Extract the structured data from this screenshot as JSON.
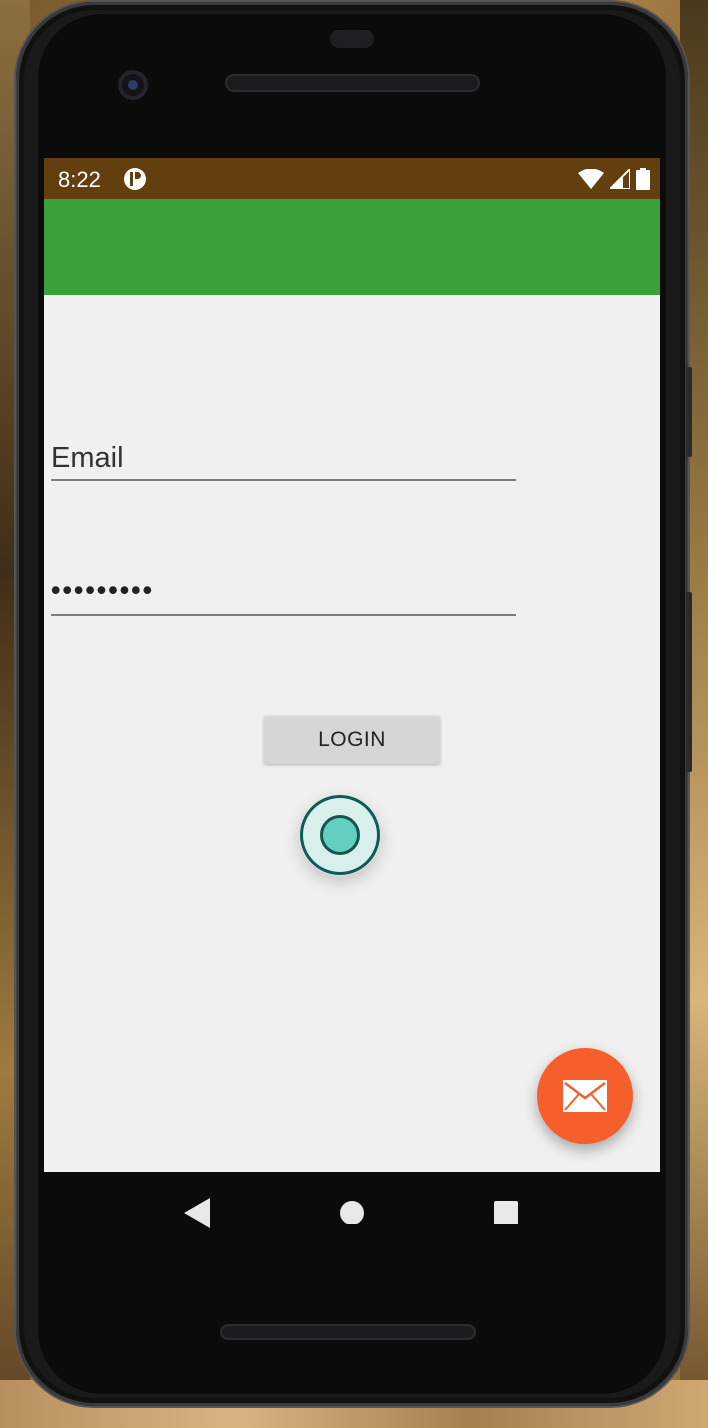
{
  "status_bar": {
    "time": "8:22",
    "icons": [
      "app-notification-icon",
      "wifi-icon",
      "signal-icon",
      "battery-icon"
    ],
    "background": "#633f10"
  },
  "app_bar": {
    "background": "#3aa13d"
  },
  "form": {
    "email_placeholder": "Email",
    "password_value": "•••••••••",
    "login_label": "LOGIN"
  },
  "radio": {
    "selected": true,
    "accent": "#63cfc0"
  },
  "fab": {
    "icon": "mail-icon",
    "background": "#f45f2c"
  },
  "nav_bar": {
    "buttons": [
      "back-icon",
      "home-icon",
      "recents-icon"
    ]
  }
}
